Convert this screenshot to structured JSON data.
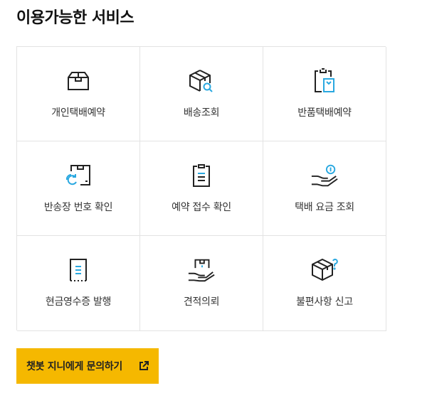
{
  "section": {
    "title": "이용가능한 서비스"
  },
  "services": [
    {
      "label": "개인택배예약",
      "icon": "box-icon"
    },
    {
      "label": "배송조회",
      "icon": "box-search-icon"
    },
    {
      "label": "반품택배예약",
      "icon": "return-clipboard-icon"
    },
    {
      "label": "반송장 번호 확인",
      "icon": "refresh-invoice-icon"
    },
    {
      "label": "예약 접수 확인",
      "icon": "clipboard-check-icon"
    },
    {
      "label": "택배 요금 조회",
      "icon": "hand-coin-icon"
    },
    {
      "label": "현금영수증 발행",
      "icon": "receipt-icon"
    },
    {
      "label": "견적의뢰",
      "icon": "hand-box-icon"
    },
    {
      "label": "불편사항 신고",
      "icon": "box-question-icon"
    }
  ],
  "chatbot": {
    "label": "챗봇 지니에게 문의하기",
    "icon": "external-link-icon"
  },
  "colors": {
    "accent": "#f5b800",
    "icon_accent": "#29a8e0",
    "border": "#e3e3e3",
    "text": "#333333"
  }
}
